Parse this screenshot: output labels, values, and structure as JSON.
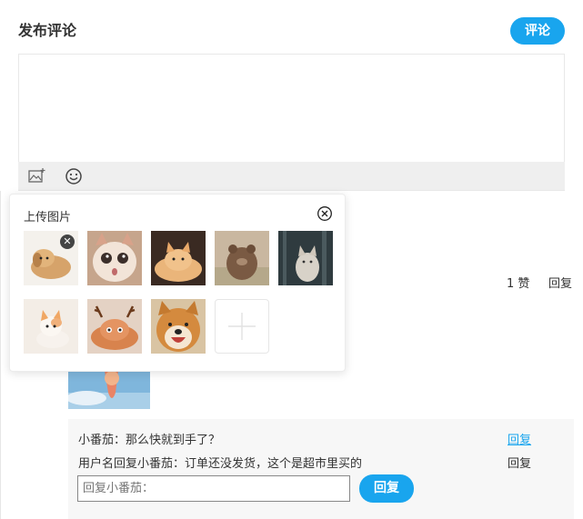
{
  "header": {
    "title": "发布评论",
    "submit_label": "评论"
  },
  "editor": {
    "value": "",
    "toolbar": {
      "image_icon": "image-upload-icon",
      "emoji_icon": "smiley-icon"
    }
  },
  "upload_popup": {
    "title": "上传图片",
    "close_icon": "close-circle-icon",
    "images": [
      {
        "name": "puppy-on-white",
        "removable": true
      },
      {
        "name": "surprised-cat"
      },
      {
        "name": "orange-kitten"
      },
      {
        "name": "bear-in-grass"
      },
      {
        "name": "cat-in-forest"
      },
      {
        "name": "white-orange-kitten"
      },
      {
        "name": "cat-with-antlers"
      },
      {
        "name": "smiling-shiba"
      }
    ],
    "add_icon": "plus-icon"
  },
  "comment_meta": {
    "likes": "1 赞",
    "reply": "回复"
  },
  "replies": [
    {
      "text": "小番茄：那么快就到手了？",
      "action": "回复",
      "active": true
    },
    {
      "text": "用户名回复小番茄：订单还没发货，这个是超市里买的",
      "action": "回复",
      "active": false
    }
  ],
  "reply_form": {
    "placeholder": "回复小番茄：",
    "submit_label": "回复"
  },
  "colors": {
    "accent": "#19a5ee",
    "toolbar_bg": "#efefef",
    "reply_bg": "#f7f7f7"
  }
}
